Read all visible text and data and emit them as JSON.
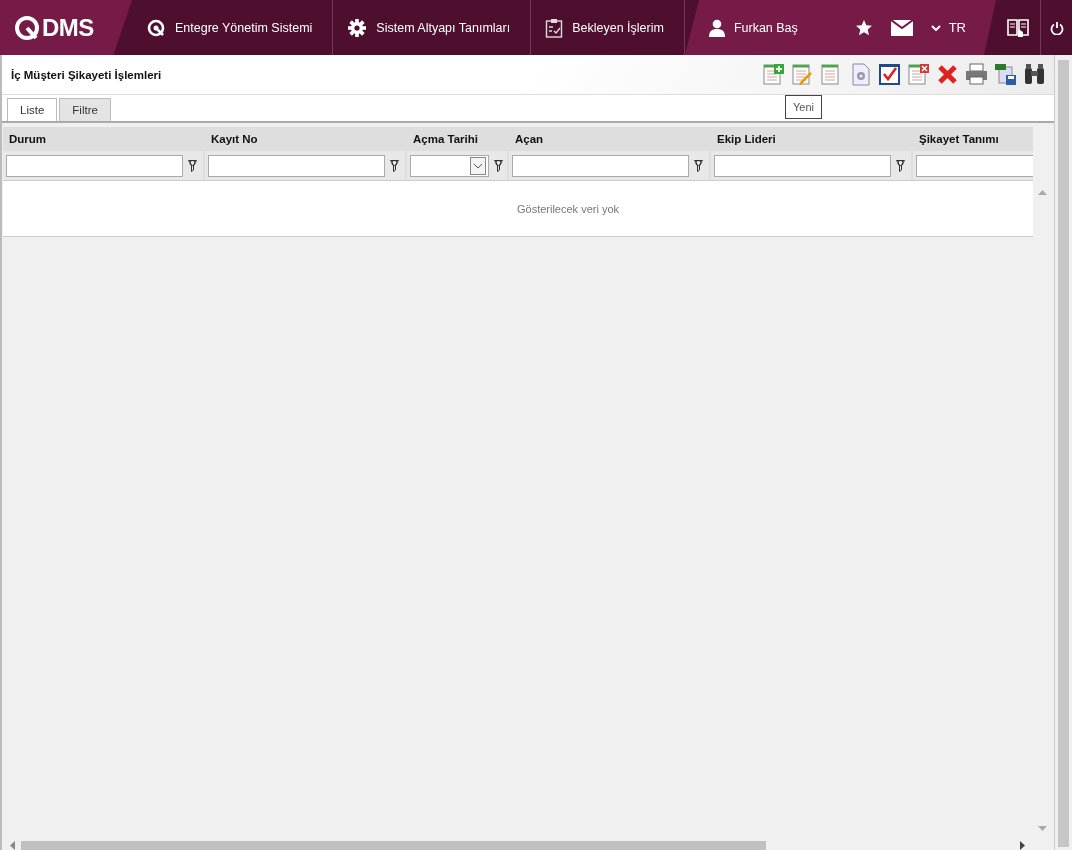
{
  "header": {
    "logo": "DMS",
    "nav": [
      {
        "label": "Entegre Yönetim Sistemi"
      },
      {
        "label": "Sistem Altyapı Tanımları"
      },
      {
        "label": "Bekleyen İşlerim"
      }
    ],
    "user": "Furkan Baş",
    "language": "TR"
  },
  "page": {
    "title": "İç Müşteri Şikayeti İşlemleri",
    "tooltip": "Yeni"
  },
  "tabs": [
    {
      "label": "Liste",
      "selected": true
    },
    {
      "label": "Filtre",
      "selected": false
    }
  ],
  "table": {
    "columns": [
      {
        "label": "Durum",
        "kind": "text"
      },
      {
        "label": "Kayıt No",
        "kind": "text"
      },
      {
        "label": "Açma Tarihi",
        "kind": "date"
      },
      {
        "label": "Açan",
        "kind": "text"
      },
      {
        "label": "Ekip Lideri",
        "kind": "text"
      },
      {
        "label": "Şikayet Tanımı",
        "kind": "text"
      }
    ],
    "empty_message": "Gösterilecek veri yok"
  }
}
